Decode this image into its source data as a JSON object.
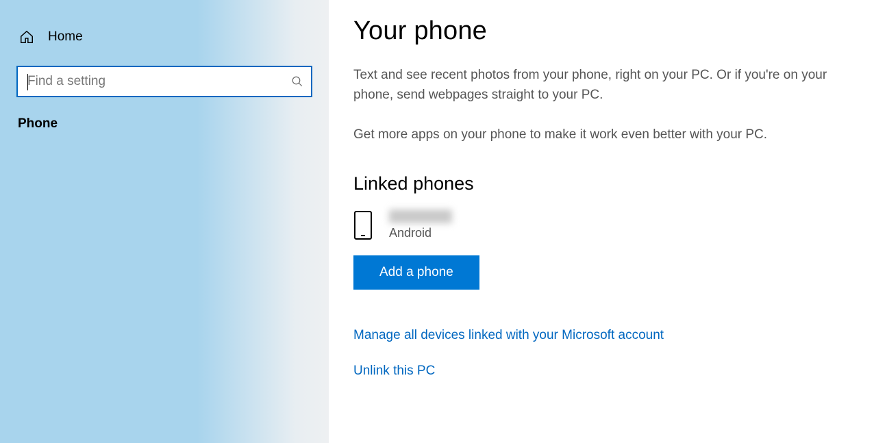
{
  "sidebar": {
    "home_label": "Home",
    "search_placeholder": "Find a setting",
    "category_label": "Phone"
  },
  "main": {
    "title": "Your phone",
    "description_p1": "Text and see recent photos from your phone, right on your PC. Or if you're on your phone, send webpages straight to your PC.",
    "description_p2": "Get more apps on your phone to make it work even better with your PC.",
    "linked_section_heading": "Linked phones",
    "linked_phone": {
      "name": "",
      "type": "Android"
    },
    "add_phone_button": "Add a phone",
    "links": {
      "manage_devices": "Manage all devices linked with your Microsoft account",
      "unlink_pc": "Unlink this PC"
    }
  },
  "colors": {
    "accent": "#0078d4",
    "link": "#0067c0"
  }
}
